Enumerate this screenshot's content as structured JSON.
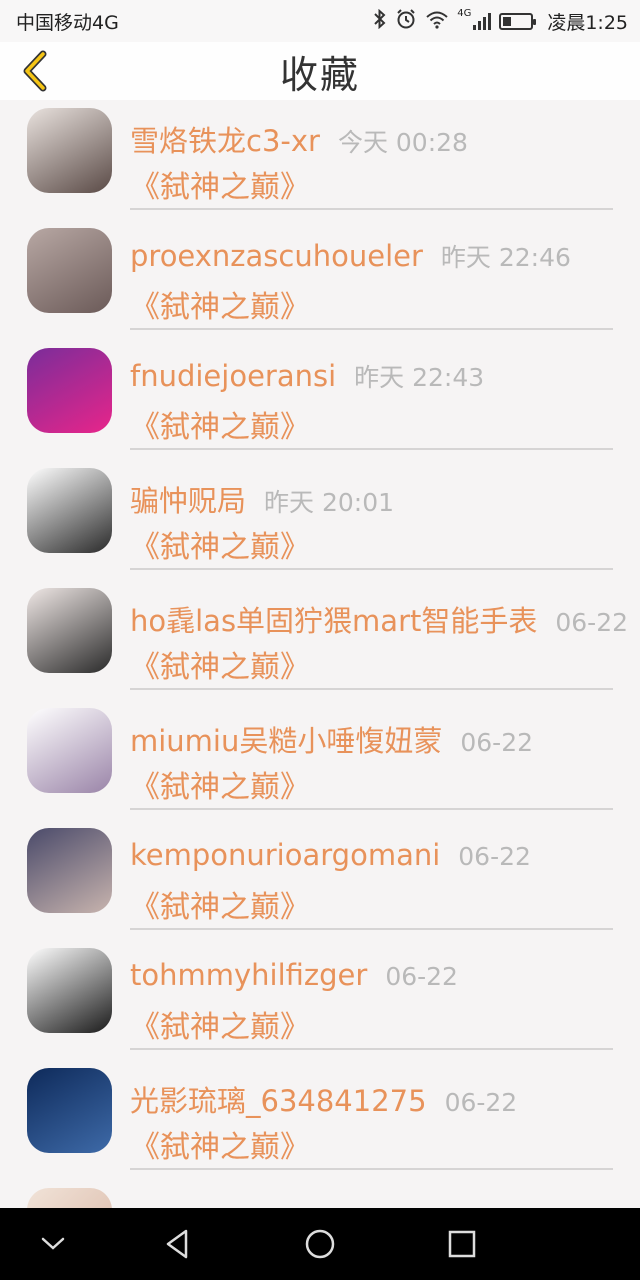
{
  "status_bar": {
    "carrier": "中国移动4G",
    "network": "4G",
    "time": "凌晨1:25",
    "battery_level": 0.3
  },
  "header": {
    "title": "收藏"
  },
  "items": [
    {
      "name": "雪烙铁龙c3-xr",
      "time": "今天 00:28",
      "book": "《弑神之巅》",
      "avatar_colors": [
        "#e9e2de",
        "#5a4a46"
      ]
    },
    {
      "name": "proexnzascuhoueler",
      "time": "昨天 22:46",
      "book": "《弑神之巅》",
      "avatar_colors": [
        "#b8a8a4",
        "#6b5a58"
      ]
    },
    {
      "name": "fnudiejoeransi",
      "time": "昨天 22:43",
      "book": "《弑神之巅》",
      "avatar_colors": [
        "#7a2d9a",
        "#e8258a"
      ]
    },
    {
      "name": "骗忡贶局",
      "time": "昨天 20:01",
      "book": "《弑神之巅》",
      "avatar_colors": [
        "#ffffff",
        "#2a2a2a"
      ]
    },
    {
      "name": "ho毳las单固狞猥mart智能手表",
      "time": "06-22",
      "book": "《弑神之巅》",
      "avatar_colors": [
        "#f0e8e6",
        "#2a2a2a"
      ]
    },
    {
      "name": "miumiu吴糙小唾愎妞蒙",
      "time": "06-22",
      "book": "《弑神之巅》",
      "avatar_colors": [
        "#ffffff",
        "#9a84a8"
      ]
    },
    {
      "name": "kemponurioargomani",
      "time": "06-22",
      "book": "《弑神之巅》",
      "avatar_colors": [
        "#4a4a6a",
        "#c8b4ae"
      ]
    },
    {
      "name": "tohmmyhilfizger",
      "time": "06-22",
      "book": "《弑神之巅》",
      "avatar_colors": [
        "#ffffff",
        "#1a1a1a"
      ]
    },
    {
      "name": "光影琉璃_634841275",
      "time": "06-22",
      "book": "《弑神之巅》",
      "avatar_colors": [
        "#0e2a5a",
        "#3e6aa8"
      ]
    }
  ],
  "colors": {
    "accent": "#e8925a",
    "time_gray": "#b9b9b9",
    "background": "#f6f4f4"
  }
}
